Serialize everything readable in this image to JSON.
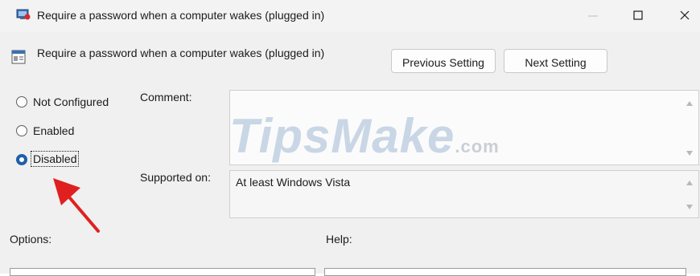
{
  "window": {
    "title": "Require a password when a computer wakes (plugged in)",
    "controls": {
      "minimize": "minimize-icon",
      "maximize": "maximize-icon",
      "close": "close-icon"
    }
  },
  "header": {
    "setting_name": "Require a password when a computer wakes (plugged in)",
    "prev_label": "Previous Setting",
    "next_label": "Next Setting"
  },
  "state": {
    "options": [
      "Not Configured",
      "Enabled",
      "Disabled"
    ],
    "selected": "Disabled"
  },
  "fields": {
    "comment_label": "Comment:",
    "comment_value": "",
    "supported_label": "Supported on:",
    "supported_value": "At least Windows Vista"
  },
  "panes": {
    "options_label": "Options:",
    "help_label": "Help:"
  },
  "watermark": {
    "brand": "TipsMake",
    "suffix": ".com"
  },
  "colors": {
    "accent": "#1e5fa8",
    "annotation_arrow": "#e02020"
  }
}
